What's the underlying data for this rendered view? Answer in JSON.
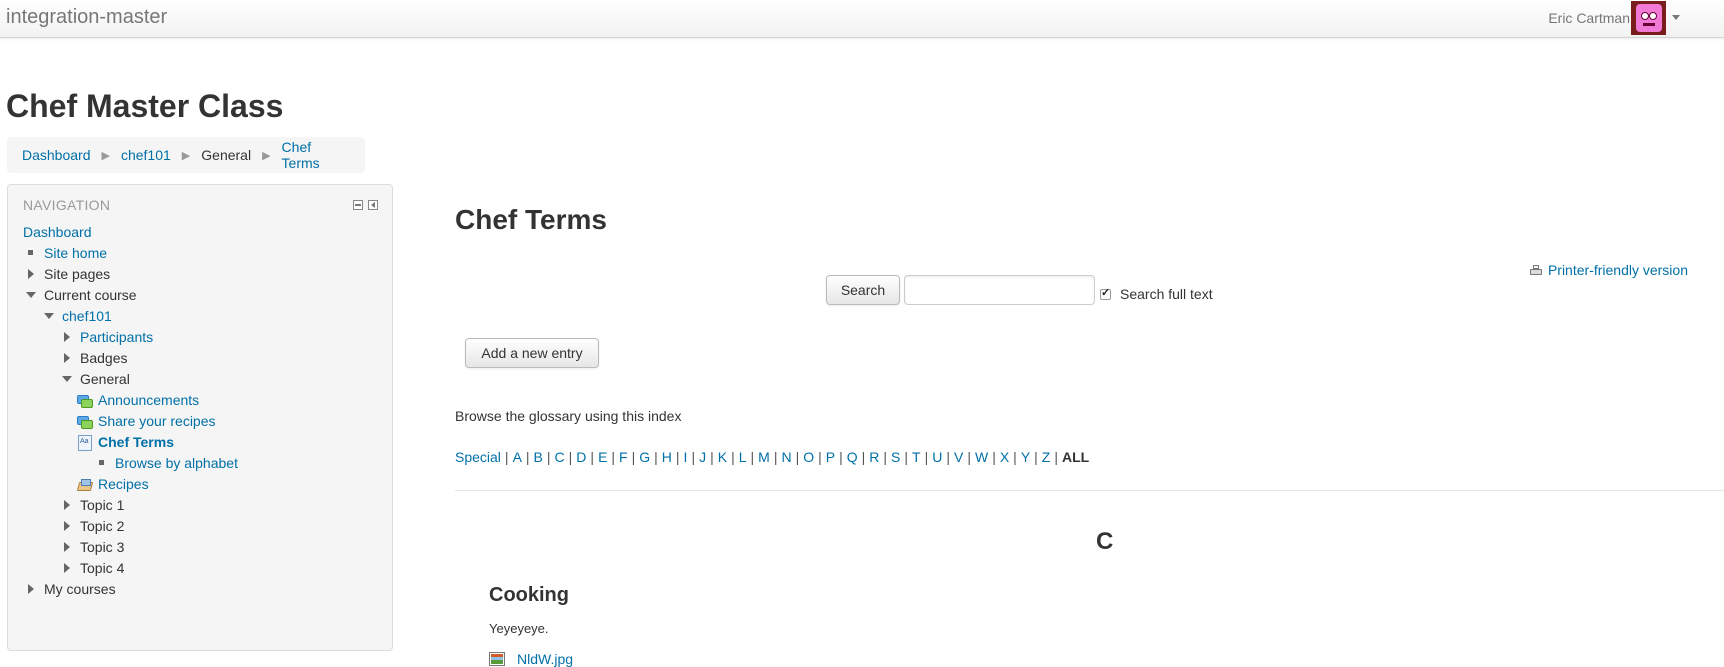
{
  "topbar": {
    "site_name": "integration-master",
    "user_name": "Eric Cartman",
    "avatar_icon": "user-avatar-icon",
    "menu_icon": "caret-down-icon"
  },
  "page_title": "Chef Master Class",
  "breadcrumb": [
    "Dashboard",
    "chef101",
    "General",
    "Chef Terms"
  ],
  "navigation": {
    "title": "NAVIGATION",
    "items": [
      "Dashboard",
      "Site home",
      "Site pages",
      "Current course",
      "chef101",
      "Participants",
      "Badges",
      "General",
      "Announcements",
      "Share your recipes",
      "Chef Terms",
      "Browse by alphabet",
      "Recipes",
      "Topic 1",
      "Topic 2",
      "Topic 3",
      "Topic 4",
      "My courses"
    ]
  },
  "main": {
    "title": "Chef Terms",
    "printer_link": "Printer-friendly version",
    "search_button": "Search",
    "search_value": "",
    "search_fulltext_label": "Search full text",
    "search_fulltext_checked": true,
    "add_entry_button": "Add a new entry",
    "browse_text": "Browse the glossary using this index",
    "alpha_index": [
      "Special",
      "A",
      "B",
      "C",
      "D",
      "E",
      "F",
      "G",
      "H",
      "I",
      "J",
      "K",
      "L",
      "M",
      "N",
      "O",
      "P",
      "Q",
      "R",
      "S",
      "T",
      "U",
      "V",
      "W",
      "X",
      "Y",
      "Z",
      "ALL"
    ],
    "alpha_index_current": "ALL",
    "letter_heading": "C",
    "entry": {
      "concept": "Cooking",
      "definition": "Yeyeyeye.",
      "attachment": "NldW.jpg"
    }
  },
  "colors": {
    "link": "#0070a8",
    "text": "#333333",
    "muted": "#999999",
    "avatar_bg": "#7a1d1d"
  }
}
